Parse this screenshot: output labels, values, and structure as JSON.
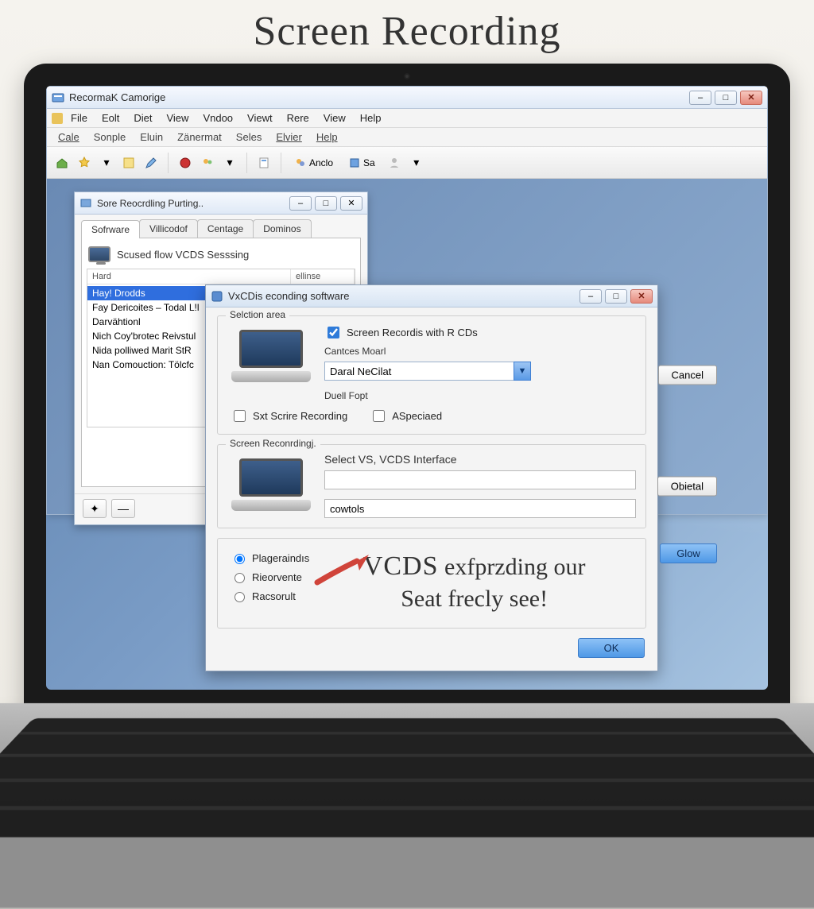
{
  "headline": "Screen Recording",
  "app": {
    "title": "RecormaK Camorige",
    "menu1": [
      "File",
      "Eolt",
      "Diet",
      "View",
      "Vndoo",
      "Viewt",
      "Rere",
      "View",
      "Help"
    ],
    "menu2": [
      "Cale",
      "Sonple",
      "Eluin",
      "Zänermat",
      "Seles",
      "Elvier",
      "Help"
    ],
    "toolbar_anclo": "Anclo",
    "toolbar_sa": "Sa"
  },
  "panel": {
    "title": "Sore Reocrdling Purting..",
    "tabs": [
      "Sofrware",
      "Villicodof",
      "Centage",
      "Dominos"
    ],
    "heading": "Scused flow VCDS Sesssing",
    "tree_cols": [
      "Hard",
      "ellinse"
    ],
    "tree": [
      "Hay! Drodds",
      "Fay Dericoites – Todal L!l",
      "Darvähtionl",
      "Nich Coy'brotec Reivstul",
      "Nida polliwed Marit StR",
      "Nan Comouction: Tölcfc"
    ]
  },
  "dialog": {
    "title": "VxCDis econding software",
    "section1": {
      "legend": "Selction area",
      "check_screen": "Screen Recordis with R CDs",
      "label_cantces": "Cantces Moarl",
      "combo_value": "Daral NeCilat",
      "label_duell": "Duell Fopt",
      "check_sxt": "Sxt Scrire Recording",
      "check_asp": "ASpeciaed",
      "btn_cancel": "Cancel"
    },
    "section2": {
      "legend": "Screen Reconrdingj.",
      "label_select": "Select VS, VCDS Interface",
      "input_value": "",
      "input2_value": "cowtols",
      "btn_obietal": "Obietal"
    },
    "radios": [
      "Plageraindıs",
      "Rieorvente",
      "Racsorult"
    ],
    "callout_em": "VCDS",
    "callout_rest1": "exfprzding our",
    "callout_rest2": "Seat frecly see!",
    "btn_glow": "Glow",
    "btn_ok": "OK"
  }
}
